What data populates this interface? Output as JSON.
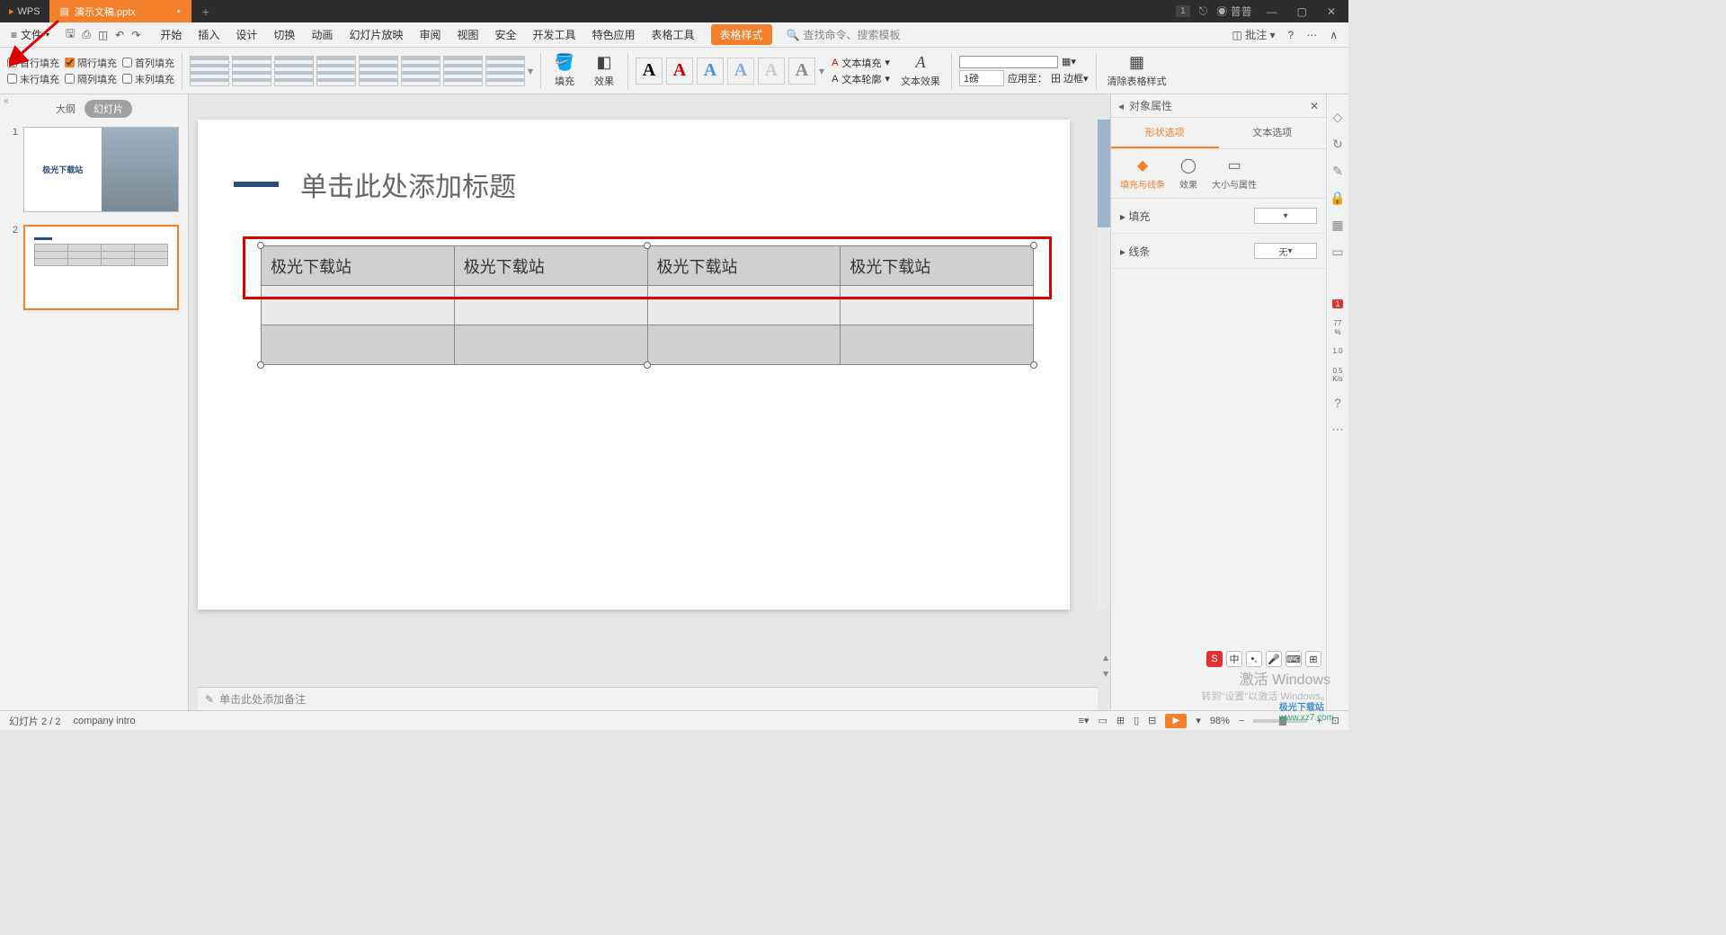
{
  "titlebar": {
    "app": "WPS",
    "tab": "演示文稿.pptx",
    "notif": "1",
    "user": "普普"
  },
  "menu": {
    "file": "文件",
    "items": [
      "开始",
      "插入",
      "设计",
      "切换",
      "动画",
      "幻灯片放映",
      "审阅",
      "视图",
      "安全",
      "开发工具",
      "特色应用",
      "表格工具",
      "表格样式"
    ],
    "search": "查找命令、搜索模板",
    "approve": "批注"
  },
  "ribbon": {
    "checks": {
      "r1c1": "首行填充",
      "r1c2": "隔行填充",
      "r1c3": "首列填充",
      "r2c1": "末行填充",
      "r2c2": "隔列填充",
      "r2c3": "末列填充"
    },
    "fill": "填充",
    "effect": "效果",
    "textfill": "文本填充",
    "textoutline": "文本轮廓",
    "texteffect": "文本效果",
    "weight": "1磅",
    "applyto": "应用至：",
    "border": "边框",
    "clearstyle": "清除表格样式"
  },
  "slidepanel": {
    "outline": "大纲",
    "slides": "幻灯片",
    "thumb1_text": "极光下载站"
  },
  "slide": {
    "title_placeholder": "单击此处添加标题",
    "cell": "极光下载站",
    "notes": "单击此处添加备注"
  },
  "prop": {
    "title": "对象属性",
    "tab_shape": "形状选项",
    "tab_text": "文本选项",
    "sub_fill": "填充与线条",
    "sub_effect": "效果",
    "sub_size": "大小与属性",
    "sect_fill": "填充",
    "sect_line": "线条",
    "line_none": "无"
  },
  "status": {
    "slide_info": "幻灯片 2 / 2",
    "title": "company intro",
    "zoom": "98%"
  },
  "watermark": {
    "l1": "激活 Windows",
    "l2": "转到\"设置\"以激活 Windows。",
    "logo": "极光下载站",
    "url": "www.xz7.com"
  },
  "rail": {
    "pct": "77",
    "v1": "1.0",
    "v2": "0.5",
    "unit": "K/s"
  }
}
